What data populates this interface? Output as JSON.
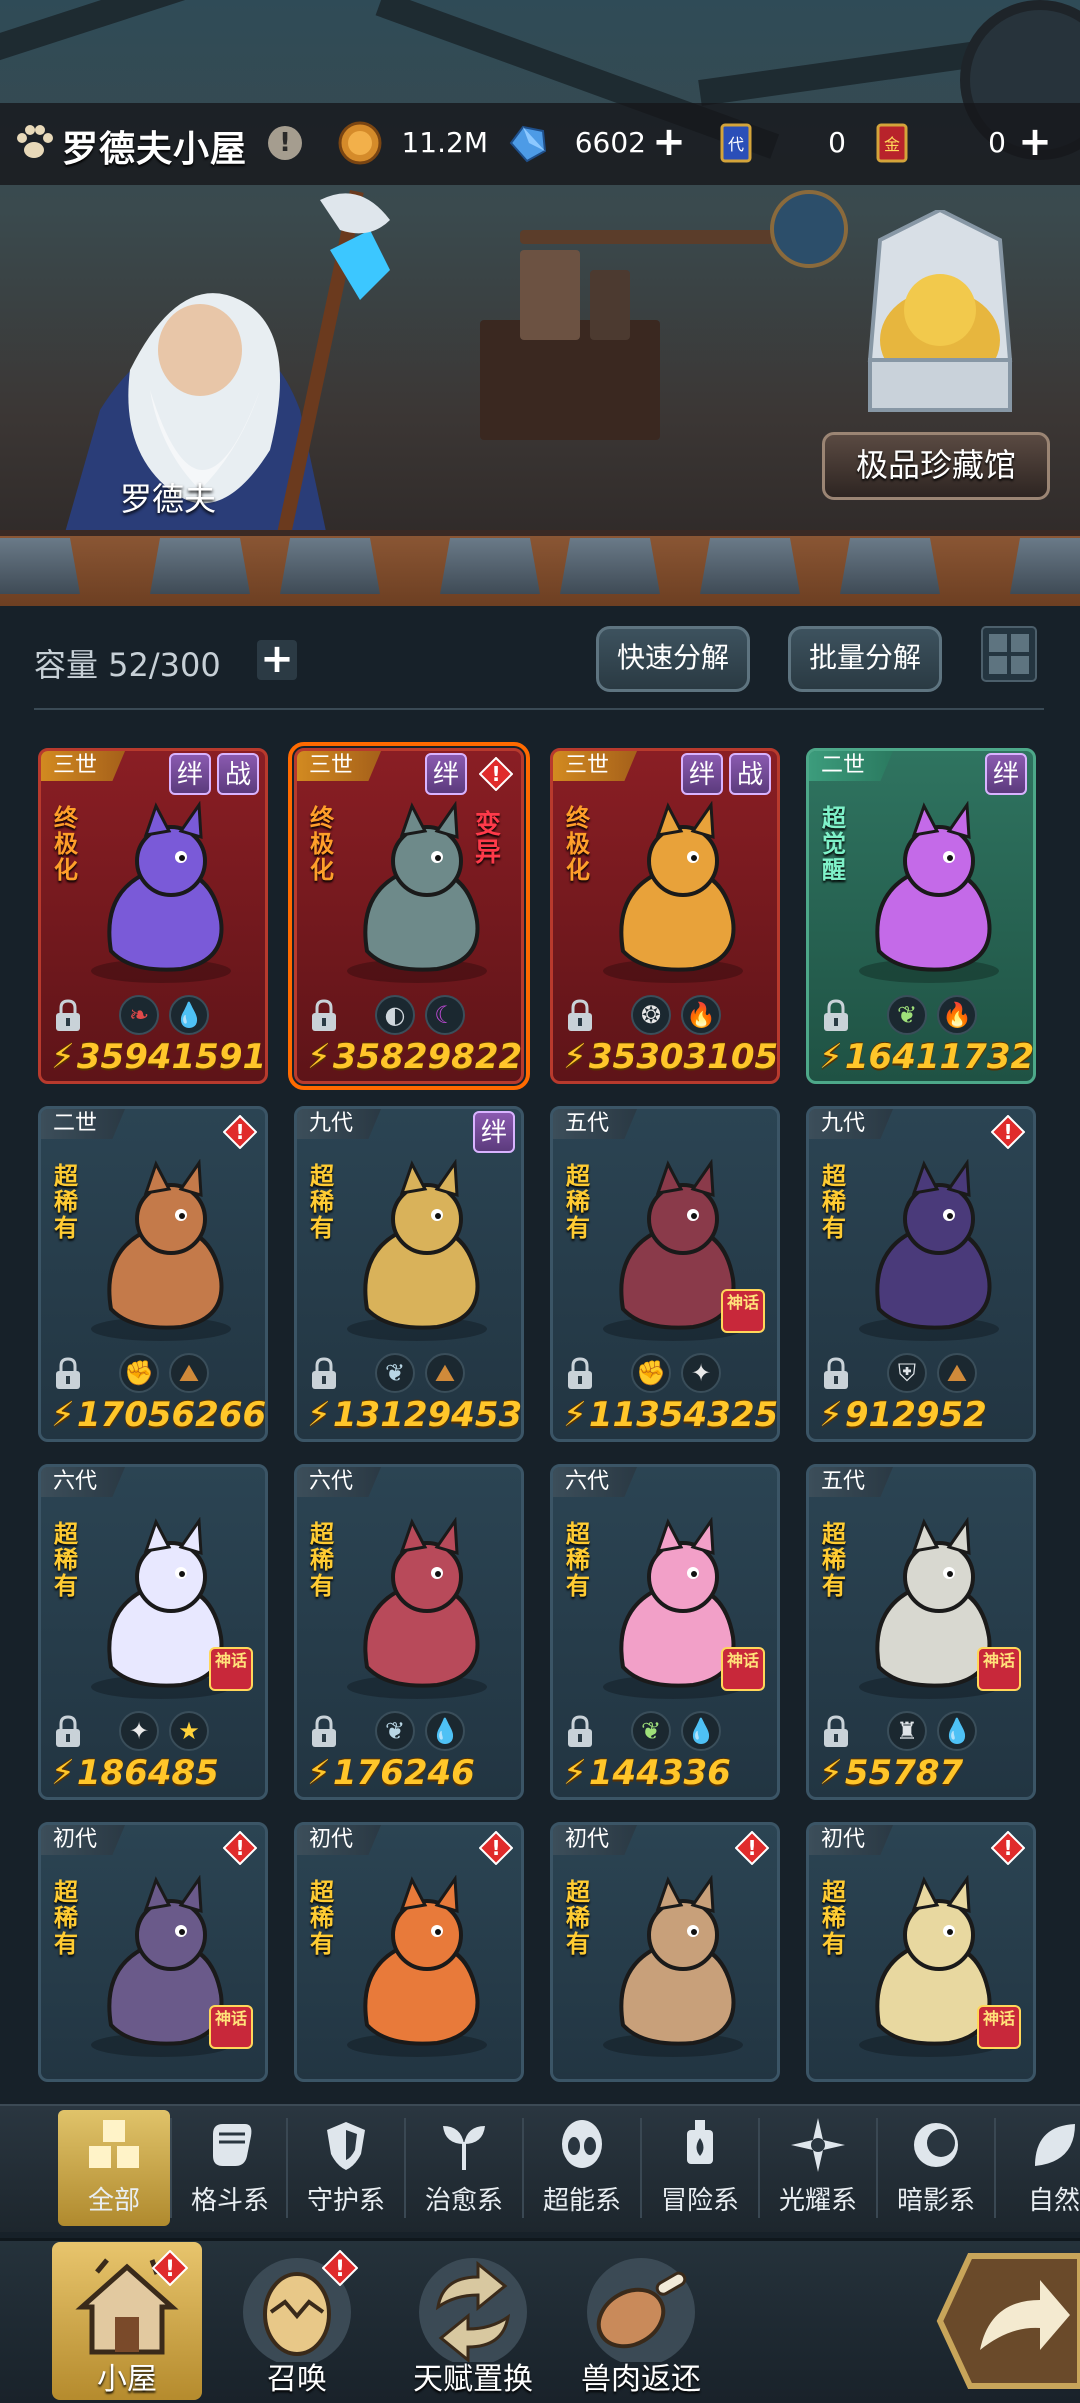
{
  "header": {
    "title": "罗德夫小屋",
    "coins": "11.2M",
    "crystals": "6602",
    "ticket_a": "0",
    "ticket_b": "0"
  },
  "scene": {
    "npc_name": "罗德夫",
    "collection_button": "极品珍藏馆"
  },
  "capacity": {
    "label": "容量 52/300"
  },
  "actions": {
    "quick_decompose": "快速分解",
    "batch_decompose": "批量分解"
  },
  "pets": [
    {
      "generation": "三世",
      "rarity": "终极化",
      "power": "35941591",
      "bond": "绊",
      "extra_badge": "战",
      "alert": false,
      "theme": "red",
      "types": [
        "fire-leaf",
        "water"
      ]
    },
    {
      "generation": "三世",
      "rarity": "终极化",
      "power": "35829822",
      "bond": "绊",
      "extra_badge": "",
      "alert": true,
      "theme": "red",
      "types": [
        "shadow",
        "psychic"
      ],
      "mutation": "变异"
    },
    {
      "generation": "三世",
      "rarity": "终极化",
      "power": "35303105",
      "bond": "绊",
      "extra_badge": "战",
      "alert": false,
      "theme": "red",
      "types": [
        "super",
        "fire"
      ]
    },
    {
      "generation": "二世",
      "rarity": "超觉醒",
      "power": "16411732",
      "bond": "绊",
      "extra_badge": "",
      "alert": false,
      "theme": "green",
      "types": [
        "heal",
        "fire"
      ]
    },
    {
      "generation": "二世",
      "rarity": "超稀有",
      "power": "17056266",
      "bond": "",
      "extra_badge": "",
      "alert": true,
      "theme": "blue",
      "types": [
        "fight",
        "earth"
      ]
    },
    {
      "generation": "九代",
      "rarity": "超稀有",
      "power": "13129453",
      "bond": "绊",
      "extra_badge": "",
      "alert": false,
      "theme": "blue",
      "types": [
        "leaf",
        "earth"
      ]
    },
    {
      "generation": "五代",
      "rarity": "超稀有",
      "power": "11354325",
      "bond": "",
      "extra_badge": "",
      "alert": false,
      "theme": "blue",
      "types": [
        "fight",
        "light"
      ],
      "myth": "神话"
    },
    {
      "generation": "九代",
      "rarity": "超稀有",
      "power": "912952",
      "bond": "",
      "extra_badge": "",
      "alert": true,
      "theme": "blue",
      "types": [
        "guard",
        "earth"
      ]
    },
    {
      "generation": "六代",
      "rarity": "超稀有",
      "power": "186485",
      "bond": "",
      "extra_badge": "",
      "alert": false,
      "theme": "blue",
      "types": [
        "light",
        "star"
      ],
      "myth": "神话"
    },
    {
      "generation": "六代",
      "rarity": "超稀有",
      "power": "176246",
      "bond": "",
      "extra_badge": "",
      "alert": false,
      "theme": "blue",
      "types": [
        "leaf",
        "water"
      ]
    },
    {
      "generation": "六代",
      "rarity": "超稀有",
      "power": "144336",
      "bond": "",
      "extra_badge": "",
      "alert": false,
      "theme": "blue",
      "types": [
        "heal",
        "water"
      ],
      "myth": "神话"
    },
    {
      "generation": "五代",
      "rarity": "超稀有",
      "power": "55787",
      "bond": "",
      "extra_badge": "",
      "alert": false,
      "theme": "blue",
      "types": [
        "adventure",
        "water"
      ],
      "myth": "神话"
    },
    {
      "generation": "初代",
      "rarity": "超稀有",
      "power": "",
      "bond": "",
      "extra_badge": "",
      "alert": true,
      "theme": "blue",
      "types": [],
      "myth": "神话"
    },
    {
      "generation": "初代",
      "rarity": "超稀有",
      "power": "",
      "bond": "",
      "extra_badge": "",
      "alert": true,
      "theme": "blue",
      "types": []
    },
    {
      "generation": "初代",
      "rarity": "超稀有",
      "power": "",
      "bond": "",
      "extra_badge": "",
      "alert": true,
      "theme": "blue",
      "types": []
    },
    {
      "generation": "初代",
      "rarity": "超稀有",
      "power": "",
      "bond": "",
      "extra_badge": "",
      "alert": true,
      "theme": "blue",
      "types": [],
      "myth": "神话"
    }
  ],
  "filters": [
    {
      "label": "全部",
      "icon": "grid-blocks-icon",
      "active": true
    },
    {
      "label": "格斗系",
      "icon": "fist-icon"
    },
    {
      "label": "守护系",
      "icon": "shield-wing-icon"
    },
    {
      "label": "治愈系",
      "icon": "sprout-icon"
    },
    {
      "label": "超能系",
      "icon": "alien-head-icon"
    },
    {
      "label": "冒险系",
      "icon": "lantern-icon"
    },
    {
      "label": "光耀系",
      "icon": "star-cross-icon"
    },
    {
      "label": "暗影系",
      "icon": "eclipse-icon"
    },
    {
      "label": "自然",
      "icon": "leaf-icon"
    }
  ],
  "nav": [
    {
      "label": "小屋",
      "icon": "house-icon",
      "active": true,
      "alert": true
    },
    {
      "label": "召唤",
      "icon": "egg-icon",
      "alert": true
    },
    {
      "label": "天赋置换",
      "icon": "swap-arrows-icon"
    },
    {
      "label": "兽肉返还",
      "icon": "meat-bone-icon"
    }
  ]
}
